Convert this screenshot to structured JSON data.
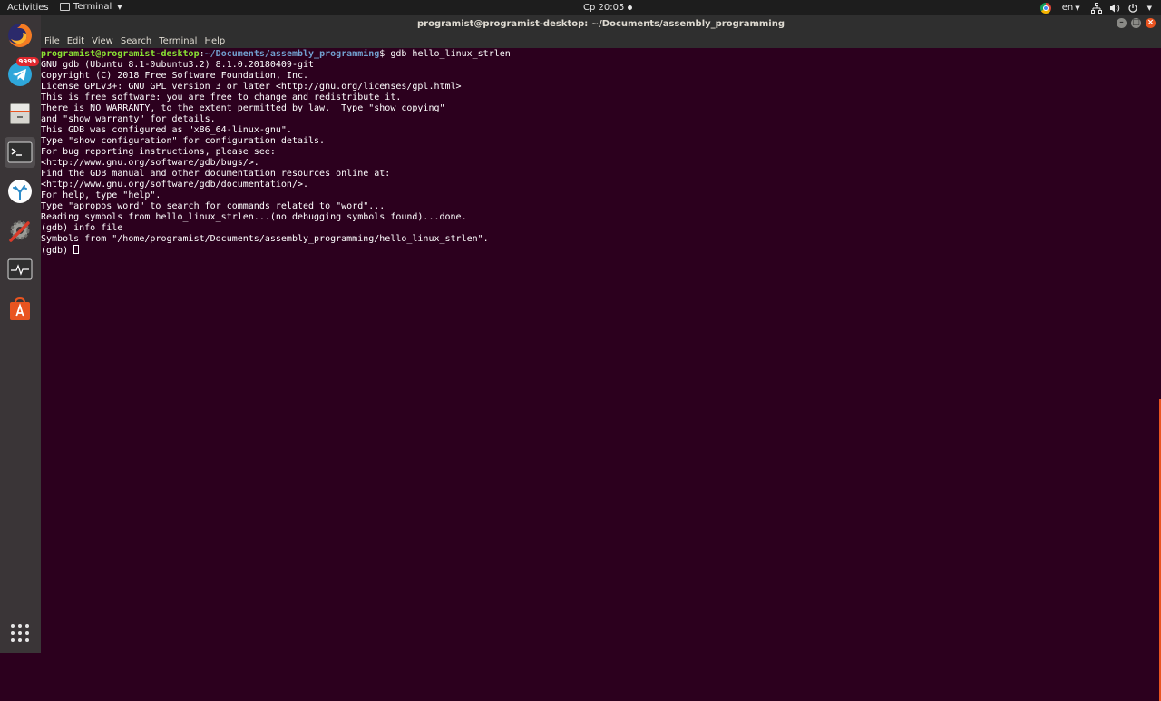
{
  "top_panel": {
    "activities": "Activities",
    "app_name": "Terminal",
    "clock": "Ср 20:05",
    "language": "en"
  },
  "dock": {
    "telegram_badge": "9999"
  },
  "window": {
    "title": "programist@programist-desktop: ~/Documents/assembly_programming"
  },
  "menu": {
    "items": [
      "File",
      "Edit",
      "View",
      "Search",
      "Terminal",
      "Help"
    ]
  },
  "terminal": {
    "prompt_user": "programist@programist-desktop",
    "prompt_sep": ":",
    "prompt_path": "~/Documents/assembly_programming",
    "command": "$ gdb hello_linux_strlen",
    "lines": [
      "GNU gdb (Ubuntu 8.1-0ubuntu3.2) 8.1.0.20180409-git",
      "Copyright (C) 2018 Free Software Foundation, Inc.",
      "License GPLv3+: GNU GPL version 3 or later <http://gnu.org/licenses/gpl.html>",
      "This is free software: you are free to change and redistribute it.",
      "There is NO WARRANTY, to the extent permitted by law.  Type \"show copying\"",
      "and \"show warranty\" for details.",
      "This GDB was configured as \"x86_64-linux-gnu\".",
      "Type \"show configuration\" for configuration details.",
      "For bug reporting instructions, please see:",
      "<http://www.gnu.org/software/gdb/bugs/>.",
      "Find the GDB manual and other documentation resources online at:",
      "<http://www.gnu.org/software/gdb/documentation/>.",
      "For help, type \"help\".",
      "Type \"apropos word\" to search for commands related to \"word\"...",
      "Reading symbols from hello_linux_strlen...(no debugging symbols found)...done.",
      "(gdb) info file",
      "Symbols from \"/home/programist/Documents/assembly_programming/hello_linux_strlen\"."
    ],
    "final_prompt": "(gdb) "
  }
}
